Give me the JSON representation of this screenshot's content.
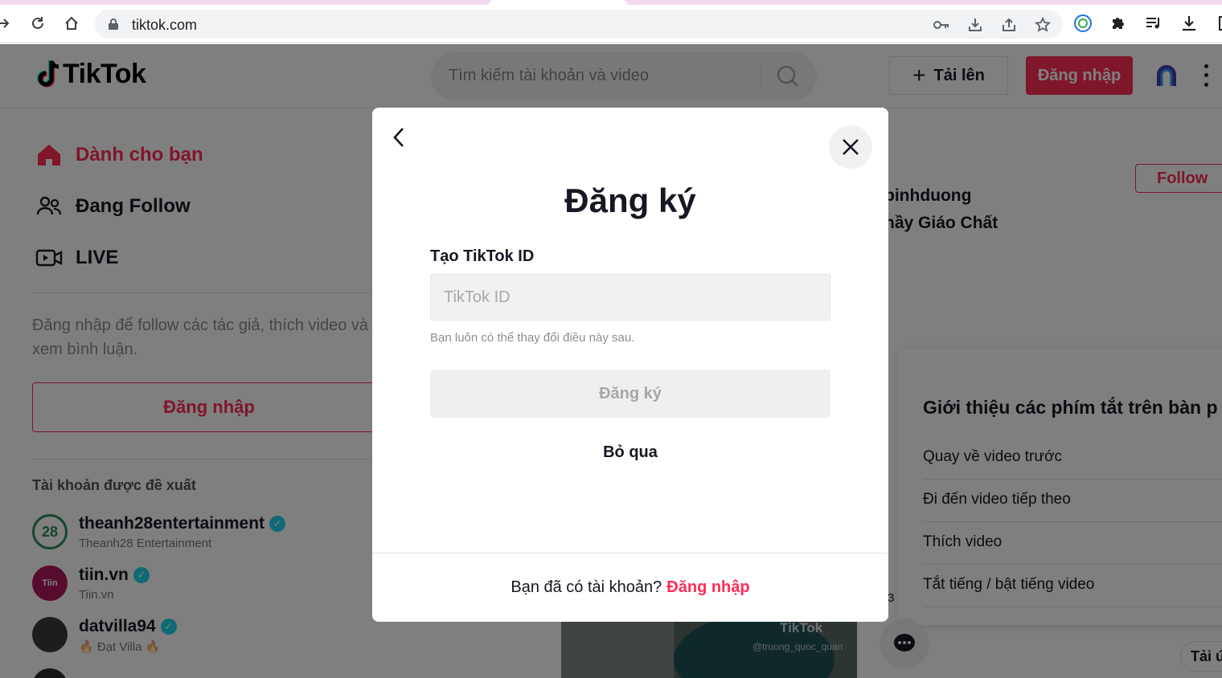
{
  "browser": {
    "url": "tiktok.com"
  },
  "header": {
    "logo": "TikTok",
    "search_placeholder": "Tìm kiếm tài khoản và video",
    "upload_label": "Tải lên",
    "login_label": "Đăng nhập"
  },
  "sidebar": {
    "nav": [
      {
        "label": "Dành cho bạn",
        "icon": "home-icon"
      },
      {
        "label": "Đang Follow",
        "icon": "following-icon"
      },
      {
        "label": "LIVE",
        "icon": "live-icon"
      }
    ],
    "login_prompt": "Đăng nhập để follow các tác giả, thích video và xem bình luận.",
    "login_button": "Đăng nhập",
    "suggested_title": "Tài khoản được đề xuất",
    "accounts": [
      {
        "username": "theanh28entertainment",
        "nickname": "Theanh28 Entertainment",
        "avatar_text": "28"
      },
      {
        "username": "tiin.vn",
        "nickname": "Tiin.vn",
        "avatar_text": "Tiin"
      },
      {
        "username": "datvilla94",
        "nickname": "🔥 Đạt Villa 🔥",
        "avatar_text": ""
      }
    ]
  },
  "feed": {
    "follow_label": "Follow",
    "author": "binhduong",
    "desc": "hầy Giáo Chất",
    "watermark": "TikTok",
    "watermark_user": "@truong_quoc_quan",
    "side_count": "3",
    "get_app": "Tải ứ"
  },
  "shortcuts": {
    "title": "Giới thiệu các phím tắt trên bàn p",
    "items": [
      "Quay về video trước",
      "Đi đến video tiếp theo",
      "Thích video",
      "Tắt tiếng / bật tiếng video"
    ]
  },
  "modal": {
    "title": "Đăng ký",
    "field_label": "Tạo TikTok ID",
    "field_placeholder": "TikTok ID",
    "field_value": "",
    "hint": "Bạn luôn có thể thay đổi điều này sau.",
    "submit_label": "Đăng ký",
    "skip_label": "Bỏ qua",
    "footer_text": "Bạn đã có tài khoản?",
    "footer_link": "Đăng nhập"
  },
  "colors": {
    "brand": "#fe2c55",
    "verified": "#20d5ec"
  }
}
